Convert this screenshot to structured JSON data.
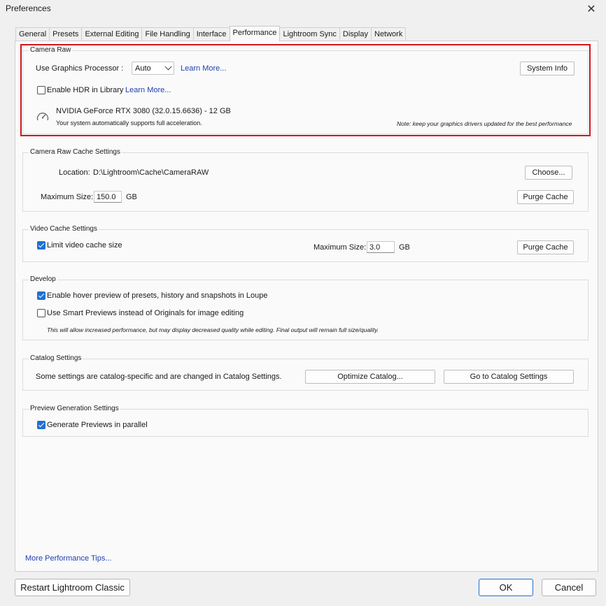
{
  "window": {
    "title": "Preferences",
    "close_icon": "close-icon"
  },
  "tabs": [
    {
      "label": "General"
    },
    {
      "label": "Presets"
    },
    {
      "label": "External Editing"
    },
    {
      "label": "File Handling"
    },
    {
      "label": "Interface"
    },
    {
      "label": "Performance",
      "active": true
    },
    {
      "label": "Lightroom Sync"
    },
    {
      "label": "Display"
    },
    {
      "label": "Network"
    }
  ],
  "camera_raw": {
    "title": "Camera Raw",
    "gpu_label": "Use Graphics Processor :",
    "gpu_value": "Auto",
    "gpu_learn_more": "Learn More...",
    "system_info_button": "System Info",
    "hdr_label": "Enable HDR in Library",
    "hdr_checked": false,
    "hdr_learn_more": "Learn More...",
    "gpu_name": "NVIDIA GeForce RTX 3080 (32.0.15.6636) - 12 GB",
    "gpu_status": "Your system automatically supports full acceleration.",
    "gpu_note": "Note: keep your graphics drivers updated for the best performance",
    "highlight_color": "#d6141c"
  },
  "cache": {
    "title": "Camera Raw Cache Settings",
    "location_label": "Location:",
    "location_value": "D:\\Lightroom\\Cache\\CameraRAW",
    "choose_button": "Choose...",
    "max_size_label": "Maximum Size:",
    "max_size_value": "150.0",
    "max_size_unit": "GB",
    "purge_button": "Purge Cache"
  },
  "video_cache": {
    "title": "Video Cache Settings",
    "limit_label": "Limit video cache size",
    "limit_checked": true,
    "max_size_label": "Maximum Size:",
    "max_size_value": "3.0",
    "max_size_unit": "GB",
    "purge_button": "Purge Cache"
  },
  "develop": {
    "title": "Develop",
    "hover_label": "Enable hover preview of presets, history and snapshots in Loupe",
    "hover_checked": true,
    "smart_label": "Use Smart Previews instead of Originals for image editing",
    "smart_checked": false,
    "smart_note": "This will allow increased performance, but may display decreased quality while editing. Final output will remain full size/quality."
  },
  "catalog": {
    "title": "Catalog Settings",
    "description": "Some settings are catalog-specific and are changed in Catalog Settings.",
    "optimize_button": "Optimize Catalog...",
    "goto_button": "Go to Catalog Settings"
  },
  "preview": {
    "title": "Preview Generation Settings",
    "parallel_label": "Generate Previews in parallel",
    "parallel_checked": true
  },
  "footer": {
    "tips_link": "More Performance Tips...",
    "restart_button": "Restart Lightroom Classic",
    "ok_button": "OK",
    "cancel_button": "Cancel"
  },
  "colors": {
    "accent": "#1f6fd1",
    "link": "#2040b0"
  }
}
